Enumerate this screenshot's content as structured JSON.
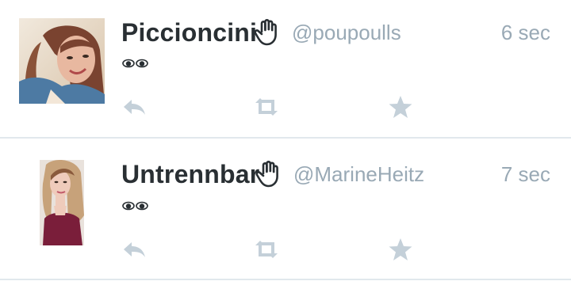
{
  "timeline": {
    "tweets": [
      {
        "display_name": "Piccioncini",
        "handle": "@poupoulls",
        "timestamp": "6 sec",
        "body_icon": "eyes-emoji",
        "avatar_icon": "profile-photo",
        "badge_icon": "raised-hand-emoji",
        "actions": [
          "reply-icon",
          "retweet-icon",
          "favorite-icon"
        ]
      },
      {
        "display_name": "Untrennbar",
        "handle": "@MarineHeitz",
        "timestamp": "7 sec",
        "body_icon": "eyes-emoji",
        "avatar_icon": "profile-photo",
        "badge_icon": "raised-hand-emoji",
        "actions": [
          "reply-icon",
          "retweet-icon",
          "favorite-icon"
        ]
      }
    ]
  },
  "colors": {
    "name": "#292f33",
    "meta": "#99a9b5",
    "action_icon": "#c4d0d9",
    "divider": "#e1e8ed",
    "background": "#ffffff"
  }
}
